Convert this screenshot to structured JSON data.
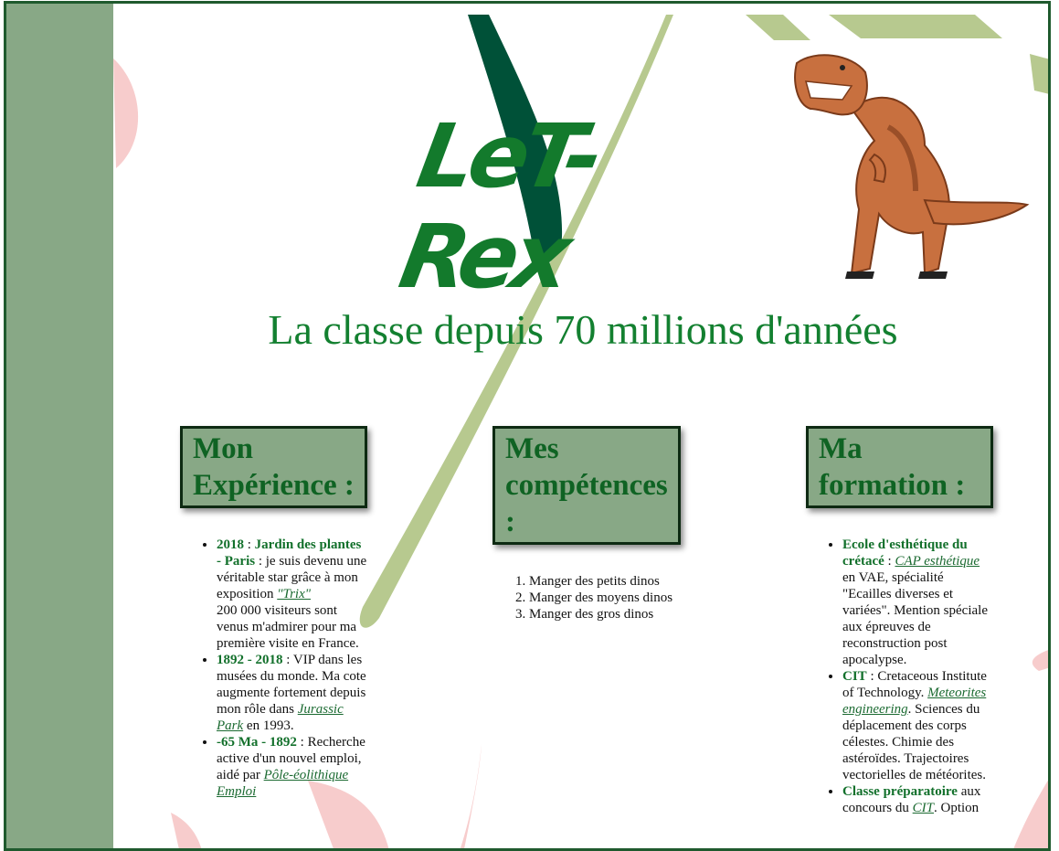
{
  "header": {
    "logo_text": "LeT-Rex",
    "tagline": "La classe depuis 70 millions d'années",
    "trex_image_name": "t-rex-figurine"
  },
  "colors": {
    "band": "#88a886",
    "dark_green": "#0f6323",
    "title_green": "#138030",
    "accent_pink": "#f7c9c9",
    "leaf_light": "#b7c98f",
    "leaf_dark": "#005138"
  },
  "experience": {
    "title": "Mon Expérience :",
    "items": [
      {
        "label": "2018",
        "sep": " : ",
        "place": "Jardin des plantes - Paris",
        "text1": " : je suis devenu une véritable star grâce à mon exposition ",
        "link": "\"Trix\"",
        "text2": "200 000 visiteurs sont venus m'admirer pour ma première visite en France."
      },
      {
        "label": "1892 - 2018",
        "text1": " : VIP dans les musées du monde. Ma cote augmente fortement depuis mon rôle dans ",
        "link": "Jurassic Park",
        "text2": " en 1993."
      },
      {
        "label": "-65 Ma - 1892",
        "text1": " : Recherche active d'un nouvel emploi, aidé par ",
        "link": "Pôle-éolithique Emploi"
      }
    ]
  },
  "skills": {
    "title": "Mes compétences :",
    "items": [
      "Manger des petits dinos",
      "Manger des moyens dinos",
      "Manger des gros dinos"
    ]
  },
  "education": {
    "title": "Ma formation :",
    "items": [
      {
        "school": "Ecole d'esthétique du crétacé",
        "sep": " : ",
        "link": "CAP esthétique",
        "text": " en VAE, spécialité \"Ecailles diverses et variées\". Mention spéciale aux épreuves de reconstruction post apocalypse."
      },
      {
        "school": "CIT",
        "sep": " : Cretaceous Institute of Technology. ",
        "link": "Meteorites engineering",
        "text": ". Sciences du déplacement des corps célestes. Chimie des astéroïdes. Trajectoires vectorielles de météorites."
      },
      {
        "school": "Classe préparatoire",
        "sep": " aux concours du ",
        "link": "CIT",
        "text": ". Option"
      }
    ]
  }
}
